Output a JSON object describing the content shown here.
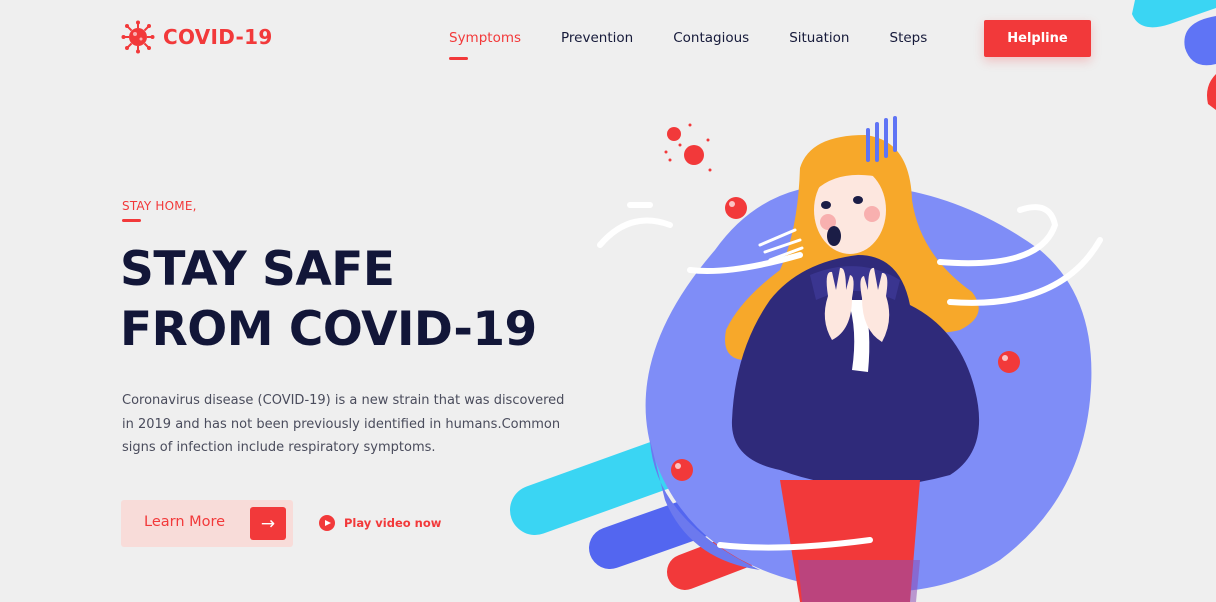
{
  "brand": {
    "name": "COVID-19",
    "logo_icon": "virus-icon",
    "color": "#f2393a"
  },
  "nav": {
    "items": [
      {
        "label": "Symptoms",
        "active": true
      },
      {
        "label": "Prevention",
        "active": false
      },
      {
        "label": "Contagious",
        "active": false
      },
      {
        "label": "Situation",
        "active": false
      },
      {
        "label": "Steps",
        "active": false
      }
    ],
    "helpline_label": "Helpline"
  },
  "hero": {
    "eyebrow": "STAY HOME,",
    "headline_line1": "STAY SAFE",
    "headline_line2": "FROM COVID-19",
    "description": "Coronavirus disease (COVID-19) is a new strain that was discovered in 2019 and has not been previously identified in humans.Common signs of infection include respiratory symptoms.",
    "learn_more_label": "Learn More",
    "learn_more_icon": "arrow-right-icon",
    "play_label": "Play video now",
    "play_icon": "play-icon"
  },
  "colors": {
    "accent": "#f2393a",
    "text_dark": "#121638",
    "blob_blue": "#7f8df7",
    "cyan": "#3ad5f3",
    "navy": "#2f2a7a",
    "hair": "#f7a82a"
  }
}
